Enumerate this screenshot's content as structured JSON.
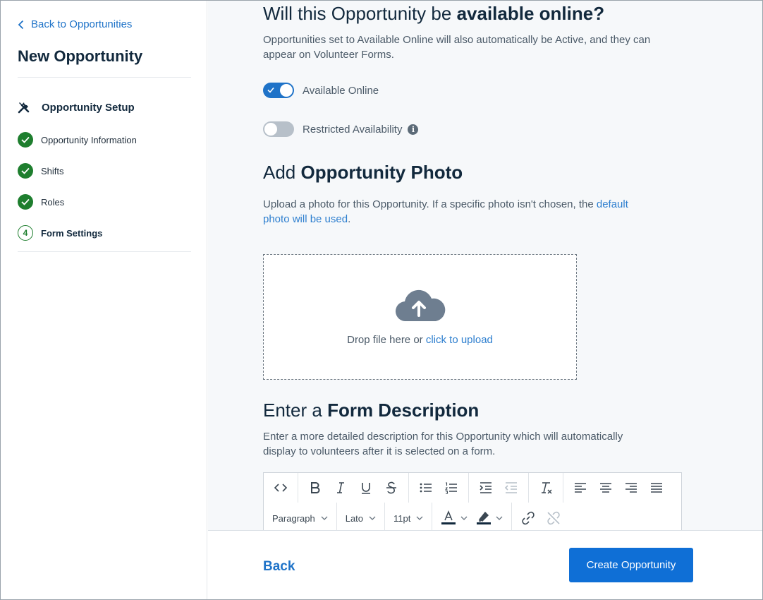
{
  "sidebar": {
    "back_label": "Back to Opportunities",
    "title": "New Opportunity",
    "setup_label": "Opportunity Setup",
    "steps": [
      {
        "label": "Opportunity Information",
        "status": "complete"
      },
      {
        "label": "Shifts",
        "status": "complete"
      },
      {
        "label": "Roles",
        "status": "complete"
      },
      {
        "label": "Form Settings",
        "status": "current",
        "number": "4"
      }
    ]
  },
  "online": {
    "heading_pre": "Will this Opportunity be ",
    "heading_bold": "available online?",
    "description": "Opportunities set to Available Online will also automatically be Active, and they can appear on Volunteer Forms.",
    "toggle_online_label": "Available Online",
    "toggle_online_state": true,
    "toggle_restricted_label": "Restricted Availability",
    "toggle_restricted_state": false,
    "info_glyph": "i"
  },
  "photo": {
    "heading_pre": "Add ",
    "heading_bold": "Opportunity Photo",
    "description_pre": "Upload a photo for this Opportunity. If a specific photo isn't chosen, the ",
    "description_link": "default photo will be used",
    "description_post": ".",
    "drop_text": "Drop file here or ",
    "drop_link": "click to upload"
  },
  "form": {
    "heading_pre": "Enter a ",
    "heading_bold": "Form Description",
    "description": "Enter a more detailed description for this Opportunity which will automatically display to volunteers after it is selected on a form."
  },
  "editor": {
    "paragraph": "Paragraph",
    "font": "Lato",
    "size": "11pt"
  },
  "footer": {
    "back_label": "Back",
    "create_label": "Create Opportunity"
  },
  "colors": {
    "accent": "#1f73c8",
    "complete": "#1e7e2e",
    "title": "#12293d"
  }
}
